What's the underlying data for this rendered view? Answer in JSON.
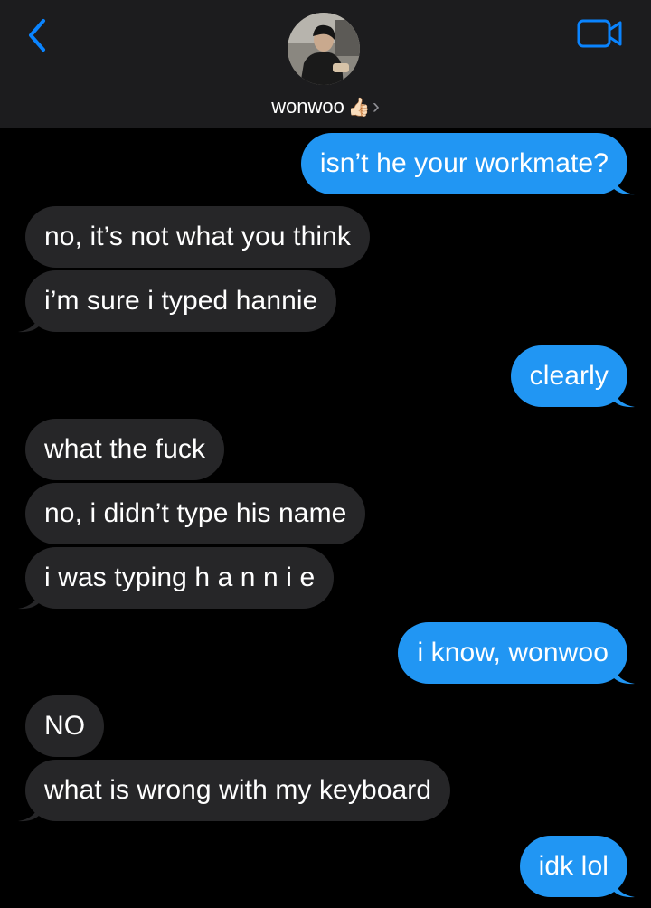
{
  "header": {
    "contact_name": "wonwoo",
    "contact_emoji": "👍🏻",
    "chevron": "›",
    "icons": {
      "back": "chevron-left-icon",
      "video": "video-camera-icon"
    },
    "accent_color": "#0a84ff"
  },
  "colors": {
    "outgoing_bubble": "#2196f3",
    "incoming_bubble": "#262628",
    "background": "#000000"
  },
  "messages": [
    {
      "direction": "out",
      "text": "isn’t he your workmate?"
    },
    {
      "direction": "in",
      "text": "no, it’s not what you think"
    },
    {
      "direction": "in",
      "text": "i’m sure i typed hannie"
    },
    {
      "direction": "out",
      "text": "clearly"
    },
    {
      "direction": "in",
      "text": "what the fuck"
    },
    {
      "direction": "in",
      "text": "no, i didn’t type his name"
    },
    {
      "direction": "in",
      "text": "i was typing h a n n i e"
    },
    {
      "direction": "out",
      "text": "i know, wonwoo"
    },
    {
      "direction": "in",
      "text": "NO"
    },
    {
      "direction": "in",
      "text": "what is wrong with my keyboard"
    },
    {
      "direction": "out",
      "text": "idk lol"
    }
  ]
}
